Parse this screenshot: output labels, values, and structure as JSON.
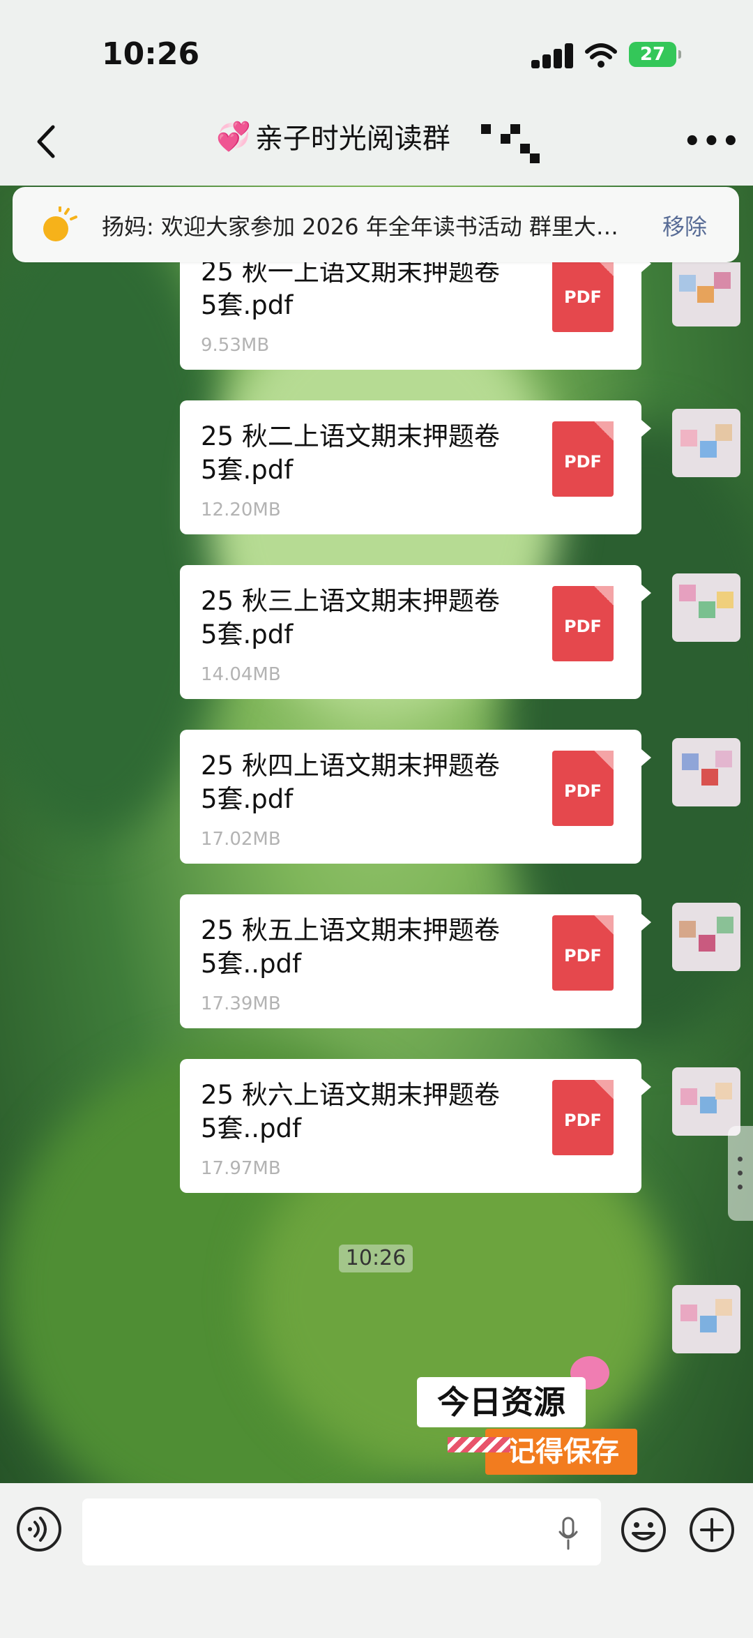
{
  "status_bar": {
    "time": "10:26",
    "battery": "27"
  },
  "nav": {
    "title": "亲子时光阅读群"
  },
  "notice": {
    "text": "扬妈: 欢迎大家参加 2026 年全年读书活动 群里大…",
    "remove_label": "移除"
  },
  "messages": [
    {
      "name_line1": "25 秋一上语文期末押题卷",
      "name_line2": "5套.pdf",
      "size": "9.53MB",
      "badge": "PDF"
    },
    {
      "name_line1": "25 秋二上语文期末押题卷",
      "name_line2": "5套.pdf",
      "size": "12.20MB",
      "badge": "PDF"
    },
    {
      "name_line1": "25 秋三上语文期末押题卷",
      "name_line2": "5套.pdf",
      "size": "14.04MB",
      "badge": "PDF"
    },
    {
      "name_line1": "25 秋四上语文期末押题卷",
      "name_line2": "5套.pdf",
      "size": "17.02MB",
      "badge": "PDF"
    },
    {
      "name_line1": "25 秋五上语文期末押题卷",
      "name_line2": "5套..pdf",
      "size": "17.39MB",
      "badge": "PDF"
    },
    {
      "name_line1": "25 秋六上语文期末押题卷",
      "name_line2": "5套..pdf",
      "size": "17.97MB",
      "badge": "PDF"
    }
  ],
  "timestamp": "10:26",
  "sticker": {
    "line1": "今日资源",
    "line2": "记得保存"
  },
  "colors": {
    "accent_pdf": "#e5484d",
    "link_blue": "#576b95",
    "sticker_orange": "#f27c1f"
  }
}
